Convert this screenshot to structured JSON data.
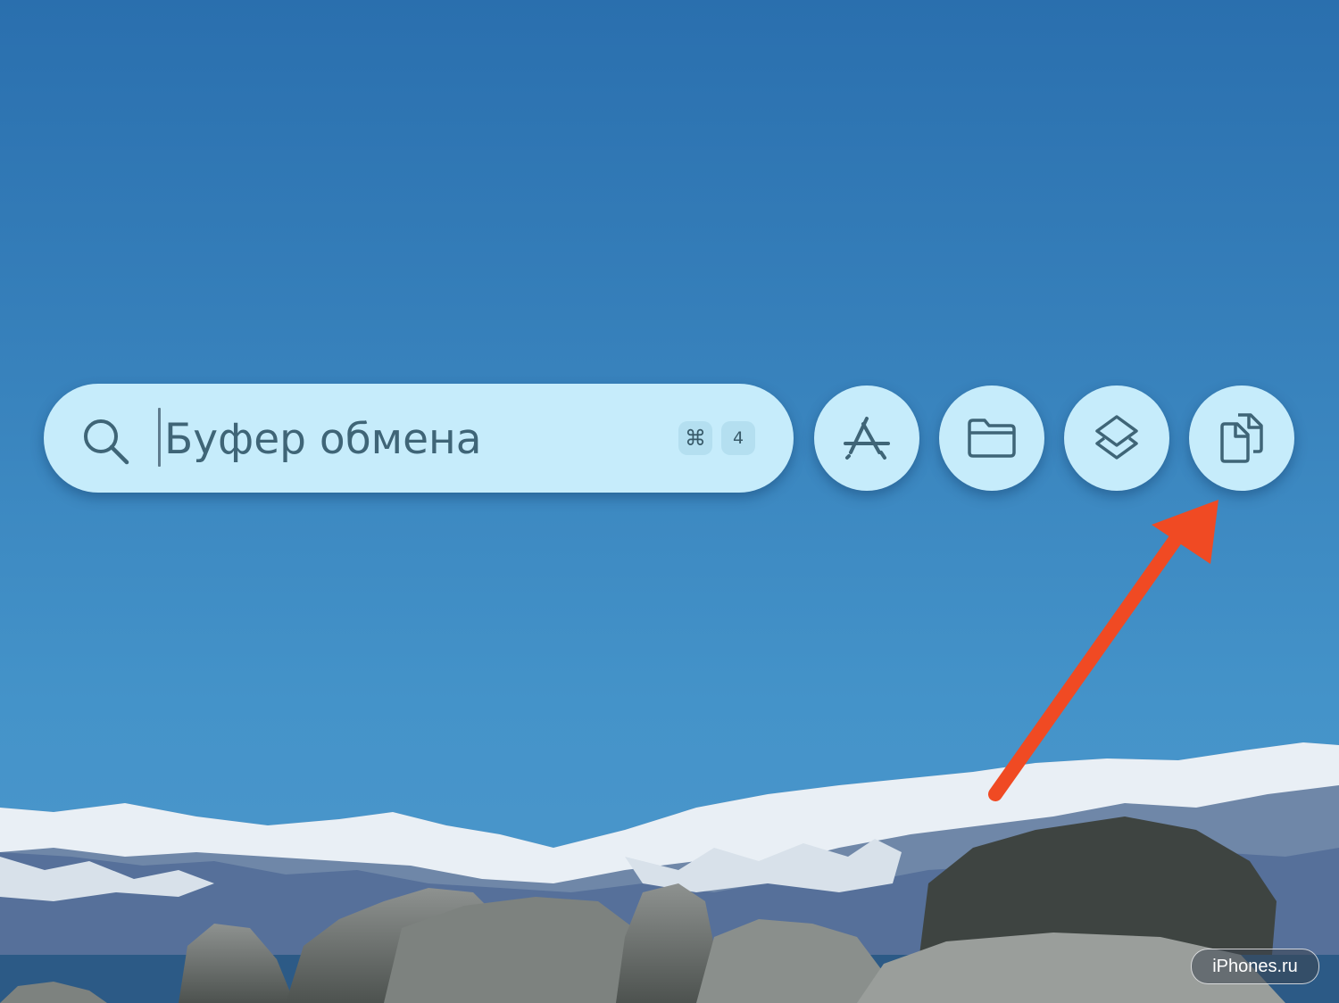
{
  "spotlight": {
    "query": "Буфер обмена",
    "shortcut_modifier": "⌘",
    "shortcut_key": "4"
  },
  "buttons": [
    {
      "icon": "app-store-icon"
    },
    {
      "icon": "folder-icon"
    },
    {
      "icon": "shortcuts-icon"
    },
    {
      "icon": "clipboard-icon"
    }
  ],
  "annotation": {
    "arrow_color": "#f04a23"
  },
  "watermark": {
    "text": "iPhones.ru"
  },
  "colors": {
    "sky_top": "#2a6fae",
    "sky_bottom": "#4b96cb",
    "pill_bg": "#c6ecfb",
    "icon_color": "#3f6577"
  }
}
